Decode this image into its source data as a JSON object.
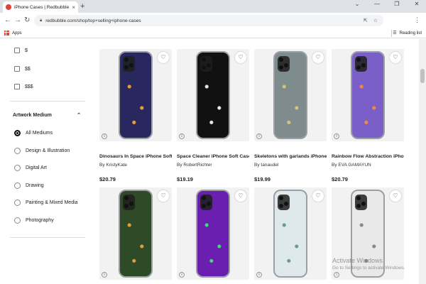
{
  "browser": {
    "tab_title": "iPhone Cases | Redbubble",
    "tab_close": "×",
    "new_tab": "+",
    "url": "redbubble.com/shop/top+selling+iphone-cases",
    "bookmarks": {
      "apps_label": "Apps",
      "reading_list_label": "Reading list"
    }
  },
  "filters": {
    "price_options": [
      "$",
      "$$",
      "$$$"
    ],
    "artwork_medium": {
      "heading": "Artwork Medium",
      "options": [
        "All Mediums",
        "Design & Illustration",
        "Digital Art",
        "Drawing",
        "Painting & Mixed Media",
        "Photography"
      ],
      "selected": "All Mediums"
    }
  },
  "products": [
    {
      "title": "Dinosaurs In Space iPhone Soft ...",
      "artist": "By KristyKate",
      "price": "$20.79",
      "case_color": "#28285e",
      "accent": "#f0a030"
    },
    {
      "title": "Space Cleaner iPhone Soft Case",
      "artist": "By RobertRichter",
      "price": "$19.19",
      "case_color": "#111111",
      "accent": "#e8e8e8"
    },
    {
      "title": "Skeletons with garlands iPhone ...",
      "artist": "By tanaudel",
      "price": "$19.99",
      "case_color": "#7f8c8d",
      "accent": "#d9c27a"
    },
    {
      "title": "Rainbow Flow Abstraction iPhon...",
      "artist": "By EVA GAMAYUN",
      "price": "$20.79",
      "case_color": "#7b5fc9",
      "accent": "#f28a3c"
    },
    {
      "title": "",
      "artist": "",
      "price": "",
      "case_color": "#2e4a26",
      "accent": "#e0a040"
    },
    {
      "title": "",
      "artist": "",
      "price": "",
      "case_color": "#6a1fb0",
      "accent": "#3ce070"
    },
    {
      "title": "",
      "artist": "",
      "price": "",
      "case_color": "#dfe9ec",
      "accent": "#6a9a8a"
    },
    {
      "title": "",
      "artist": "",
      "price": "",
      "case_color": "#e9e9e9",
      "accent": "#888888"
    }
  ],
  "watermark": {
    "line1": "Activate Windows",
    "line2": "Go to Settings to activate Windows."
  }
}
